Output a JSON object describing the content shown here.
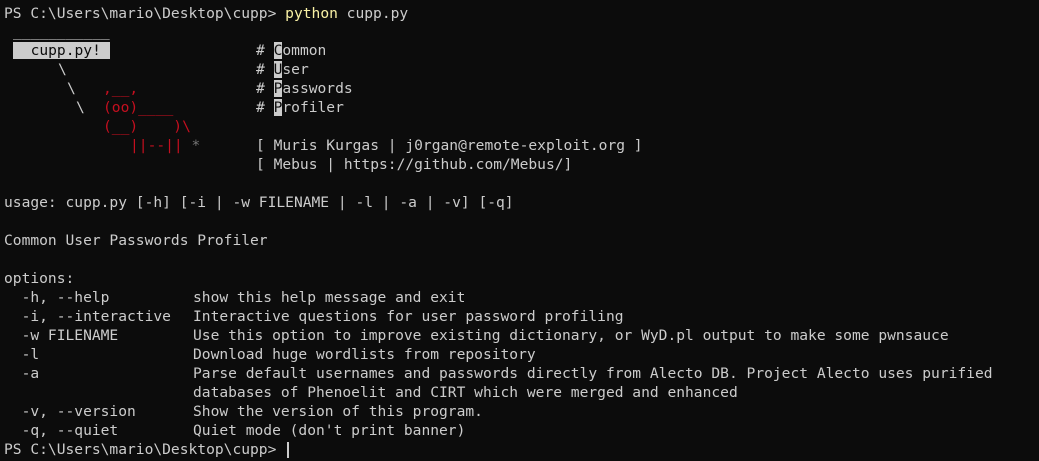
{
  "prompt1": {
    "path": "PS C:\\Users\\mario\\Desktop\\cupp> ",
    "command": "python",
    "argument": " cupp.py"
  },
  "banner": {
    "overline": "___________",
    "title": "  cupp.py! ",
    "slash1": "\\",
    "slash2": "\\",
    "cow_ears": ",__,",
    "slash3": "\\",
    "cow_face": "(oo)____",
    "cow_body": "(__)    )\\",
    "cow_legs": "||--||",
    "star": "*",
    "acronym": [
      {
        "hash": "# ",
        "initial": "C",
        "rest": "ommon"
      },
      {
        "hash": "# ",
        "initial": "U",
        "rest": "ser"
      },
      {
        "hash": "# ",
        "initial": "P",
        "rest": "asswords"
      },
      {
        "hash": "# ",
        "initial": "P",
        "rest": "rofiler"
      }
    ],
    "credit1": "[ Muris Kurgas | j0rgan@remote-exploit.org ]",
    "credit2": "[ Mebus | https://github.com/Mebus/]"
  },
  "usage": "usage: cupp.py [-h] [-i | -w FILENAME | -l | -a | -v] [-q]",
  "description": "Common User Passwords Profiler",
  "options_header": "options:",
  "options": [
    {
      "flag": "  -h, --help",
      "desc": "show this help message and exit"
    },
    {
      "flag": "  -i, --interactive",
      "desc": "Interactive questions for user password profiling"
    },
    {
      "flag": "  -w FILENAME",
      "desc": "Use this option to improve existing dictionary, or WyD.pl output to make some pwnsauce"
    },
    {
      "flag": "  -l",
      "desc": "Download huge wordlists from repository"
    },
    {
      "flag": "  -a",
      "desc": "Parse default usernames and passwords directly from Alecto DB. Project Alecto uses purified"
    },
    {
      "flag": "",
      "desc": "databases of Phenoelit and CIRT which were merged and enhanced"
    },
    {
      "flag": "  -v, --version",
      "desc": "Show the version of this program."
    },
    {
      "flag": "  -q, --quiet",
      "desc": "Quiet mode (don't print banner)"
    }
  ],
  "prompt2": {
    "path": "PS C:\\Users\\mario\\Desktop\\cupp> "
  }
}
